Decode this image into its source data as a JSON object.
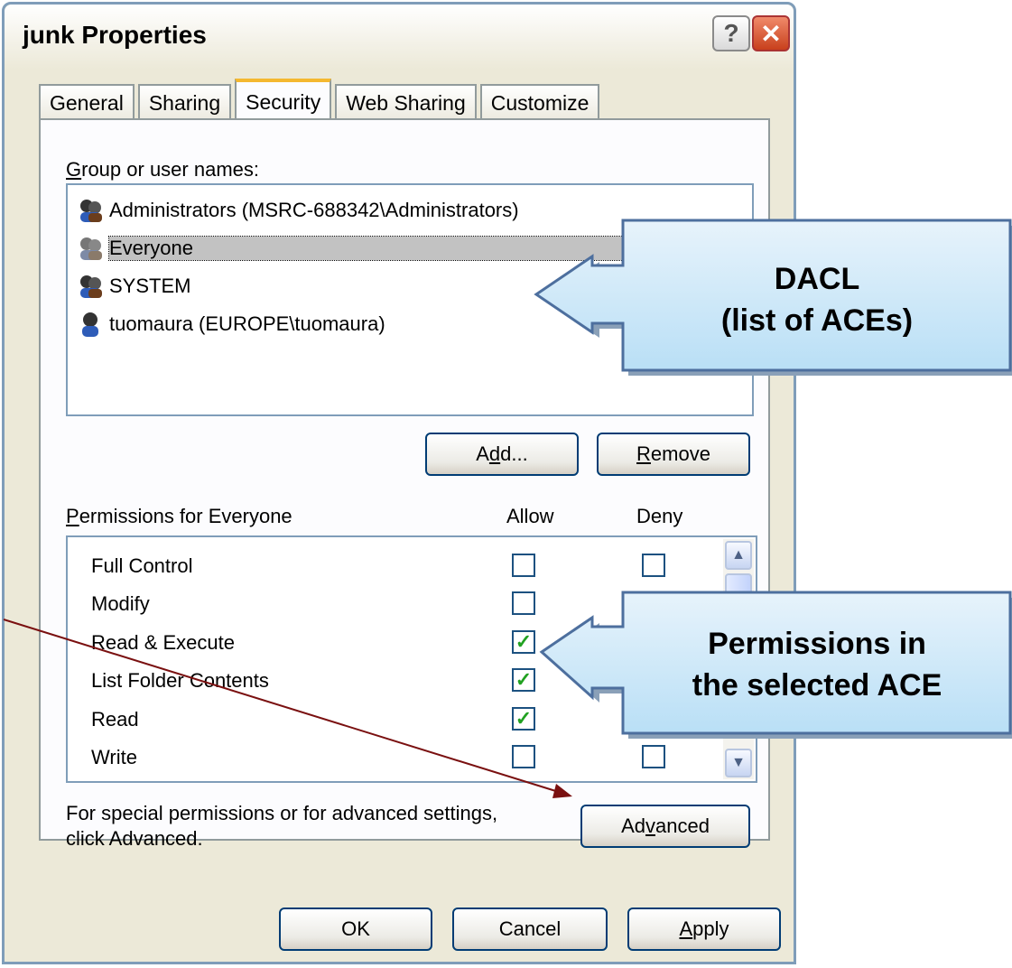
{
  "window": {
    "title": "junk Properties"
  },
  "title_buttons": {
    "help": "?",
    "close": "✕"
  },
  "tabs": [
    {
      "label": "General"
    },
    {
      "label": "Sharing"
    },
    {
      "label": "Security"
    },
    {
      "label": "Web Sharing"
    },
    {
      "label": "Customize"
    }
  ],
  "group_section": {
    "label_hot": "G",
    "label_rest": "roup or user names:",
    "users": [
      {
        "name": "Administrators (MSRC-688342\\Administrators)",
        "icon": "group-icon"
      },
      {
        "name": "Everyone",
        "icon": "group-icon",
        "selected": true
      },
      {
        "name": "SYSTEM",
        "icon": "group-icon"
      },
      {
        "name": "tuomaura (EUROPE\\tuomaura)",
        "icon": "user-icon"
      }
    ]
  },
  "buttons": {
    "add_pre": "A",
    "add_hot": "d",
    "add_post": "d...",
    "remove_hot": "R",
    "remove_rest": "emove",
    "advanced_pre": "Ad",
    "advanced_hot": "v",
    "advanced_post": "anced",
    "ok": "OK",
    "cancel": "Cancel",
    "apply_hot": "A",
    "apply_rest": "pply"
  },
  "permissions": {
    "label_hot": "P",
    "label_rest": "ermissions for Everyone",
    "allow_header": "Allow",
    "deny_header": "Deny",
    "rows": [
      {
        "name": "Full Control",
        "allow": false,
        "deny": false
      },
      {
        "name": "Modify",
        "allow": false,
        "deny": false
      },
      {
        "name": "Read & Execute",
        "allow": true,
        "deny": false
      },
      {
        "name": "List Folder Contents",
        "allow": true,
        "deny": false
      },
      {
        "name": "Read",
        "allow": true,
        "deny": false
      },
      {
        "name": "Write",
        "allow": false,
        "deny": false
      }
    ],
    "check_glyph": "✓"
  },
  "advanced_note": {
    "line1": "For special permissions or for advanced settings,",
    "line2": "click Advanced."
  },
  "callouts": {
    "dacl_line1": "DACL",
    "dacl_line2": "(list of ACEs)",
    "perm_line1": "Permissions in",
    "perm_line2": "the selected ACE"
  },
  "colors": {
    "selection": "#c2c2c2",
    "callout_fill": "#cfe8f8",
    "arrow": "#7a1010",
    "check": "#21a121"
  }
}
